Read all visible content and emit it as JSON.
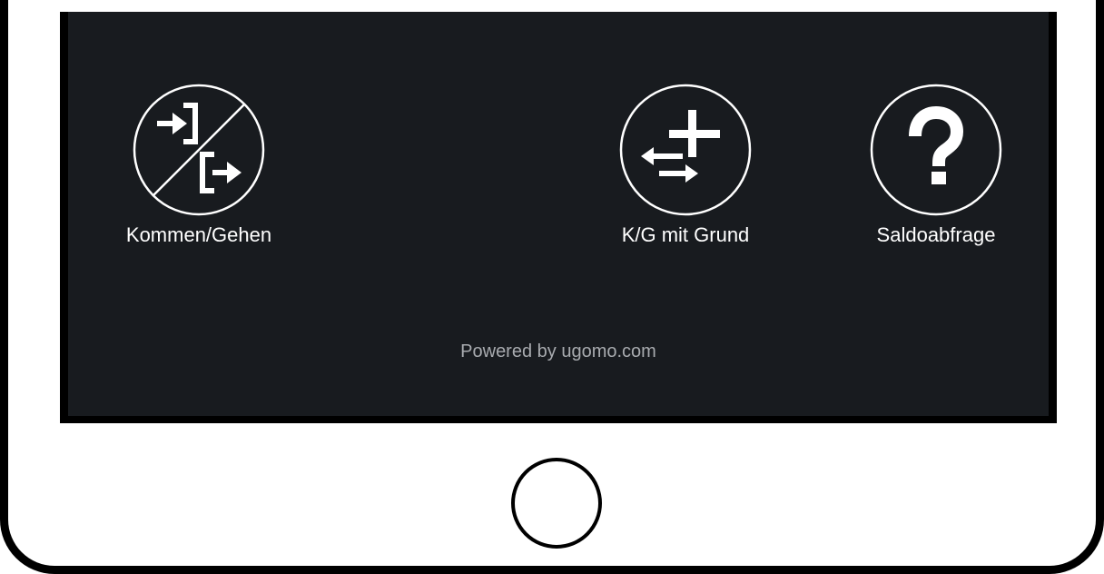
{
  "actions": {
    "kommen_gehen": {
      "label": "Kommen/Gehen",
      "icon": "clock-in-out-icon"
    },
    "kg_mit_grund": {
      "label": "K/G mit Grund",
      "icon": "transfer-plus-icon"
    },
    "saldoabfrage": {
      "label": "Saldoabfrage",
      "icon": "question-mark-icon"
    }
  },
  "footer": {
    "powered_by": "Powered by ugomo.com"
  },
  "colors": {
    "screen_background": "#181b1f",
    "text": "#ffffff",
    "footer_text": "#a8abaf",
    "frame": "#000000"
  }
}
